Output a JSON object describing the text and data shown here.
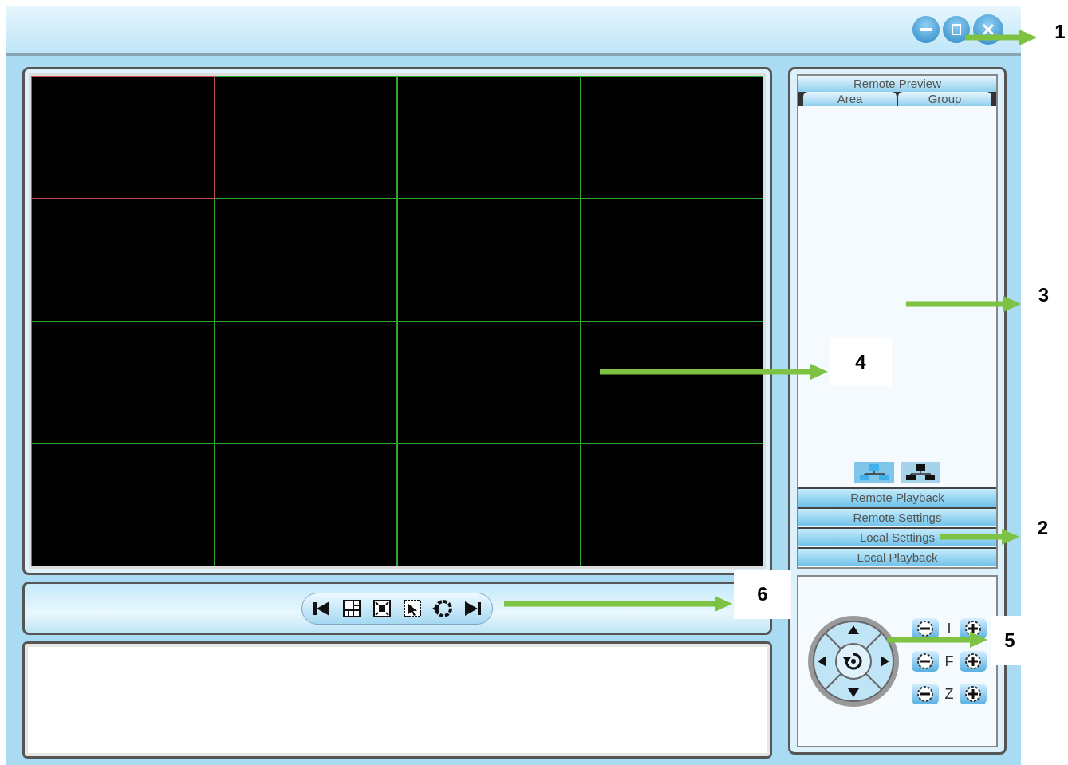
{
  "window": {
    "controls": [
      {
        "kind": "minimize"
      },
      {
        "kind": "restore"
      },
      {
        "kind": "close"
      }
    ]
  },
  "video_grid": {
    "cells": [
      {
        "selected": true
      },
      {
        "selected": false
      },
      {
        "selected": false
      },
      {
        "selected": false
      },
      {
        "selected": false
      },
      {
        "selected": false
      },
      {
        "selected": false
      },
      {
        "selected": false
      },
      {
        "selected": false
      },
      {
        "selected": false
      },
      {
        "selected": false
      },
      {
        "selected": false
      },
      {
        "selected": false
      },
      {
        "selected": false
      },
      {
        "selected": false
      },
      {
        "selected": false
      }
    ]
  },
  "toolbar": {
    "buttons": [
      {
        "kind": "previous"
      },
      {
        "kind": "layout"
      },
      {
        "kind": "fullscreen"
      },
      {
        "kind": "select"
      },
      {
        "kind": "cycle"
      },
      {
        "kind": "next"
      }
    ]
  },
  "sidebar": {
    "header": "Remote Preview",
    "tabs": [
      {
        "label": "Area"
      },
      {
        "label": "Group"
      }
    ],
    "view_buttons": [
      {
        "kind": "area",
        "selected": true
      },
      {
        "kind": "group",
        "selected": false
      }
    ],
    "menu": [
      "Remote Playback",
      "Remote Settings",
      "Local Settings",
      "Local Playback"
    ]
  },
  "ptz": {
    "rows": [
      {
        "label": "I"
      },
      {
        "label": "F"
      },
      {
        "label": "Z"
      }
    ]
  },
  "callouts": [
    {
      "label": "1"
    },
    {
      "label": "3"
    },
    {
      "label": "4"
    },
    {
      "label": "2"
    },
    {
      "label": "6"
    },
    {
      "label": "5"
    }
  ]
}
